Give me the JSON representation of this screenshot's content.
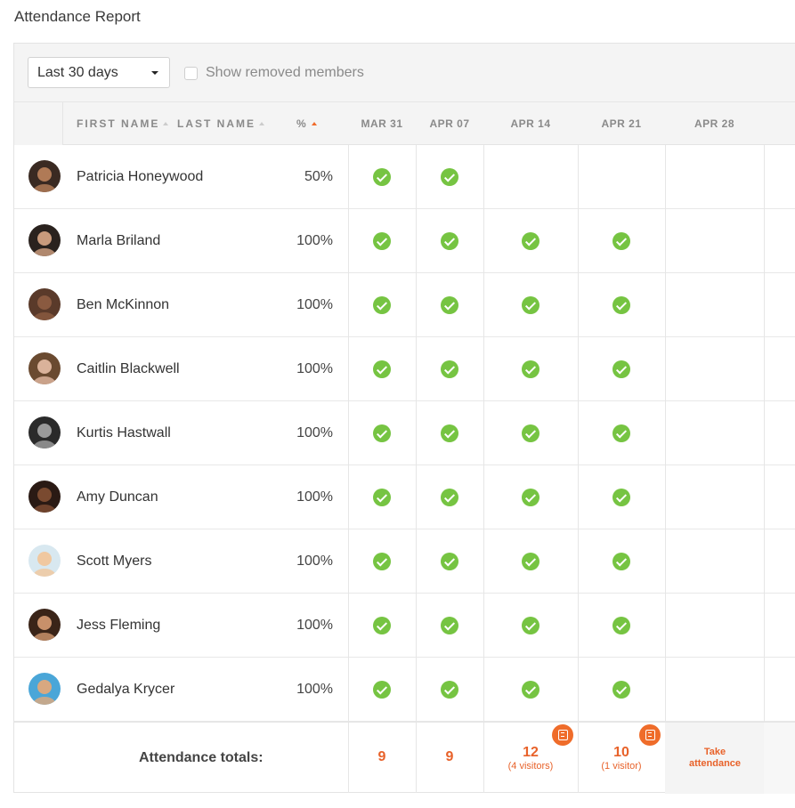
{
  "page": {
    "title": "Attendance Report"
  },
  "filters": {
    "range_label": "Last 30 days",
    "show_removed_label": "Show removed members",
    "show_removed_checked": false
  },
  "columns": {
    "first_name": "FIRST NAME",
    "last_name": "LAST NAME",
    "percent": "%",
    "dates": [
      "MAR 31",
      "APR 07",
      "APR 14",
      "APR 21",
      "APR 28"
    ]
  },
  "members": [
    {
      "name": "Patricia Honeywood",
      "percent": "50%",
      "attended": [
        true,
        true,
        false,
        false,
        false
      ],
      "avatar_color": "#3a2a22",
      "avatar_skin": "#b07a56"
    },
    {
      "name": "Marla Briland",
      "percent": "100%",
      "attended": [
        true,
        true,
        true,
        true,
        false
      ],
      "avatar_color": "#2a221e",
      "avatar_skin": "#c89a7c"
    },
    {
      "name": "Ben McKinnon",
      "percent": "100%",
      "attended": [
        true,
        true,
        true,
        true,
        false
      ],
      "avatar_color": "#5a3a2a",
      "avatar_skin": "#8a5a40"
    },
    {
      "name": "Caitlin Blackwell",
      "percent": "100%",
      "attended": [
        true,
        true,
        true,
        true,
        false
      ],
      "avatar_color": "#6a4a30",
      "avatar_skin": "#dab29a"
    },
    {
      "name": "Kurtis Hastwall",
      "percent": "100%",
      "attended": [
        true,
        true,
        true,
        true,
        false
      ],
      "avatar_color": "#2a2a2a",
      "avatar_skin": "#9a9a9a"
    },
    {
      "name": "Amy Duncan",
      "percent": "100%",
      "attended": [
        true,
        true,
        true,
        true,
        false
      ],
      "avatar_color": "#2a1a14",
      "avatar_skin": "#7a4a30"
    },
    {
      "name": "Scott Myers",
      "percent": "100%",
      "attended": [
        true,
        true,
        true,
        true,
        false
      ],
      "avatar_color": "#d8e8f0",
      "avatar_skin": "#f0c8a0"
    },
    {
      "name": "Jess Fleming",
      "percent": "100%",
      "attended": [
        true,
        true,
        true,
        true,
        false
      ],
      "avatar_color": "#3a2418",
      "avatar_skin": "#c8906a"
    },
    {
      "name": "Gedalya Krycer",
      "percent": "100%",
      "attended": [
        true,
        true,
        true,
        true,
        false
      ],
      "avatar_color": "#4aa6d8",
      "avatar_skin": "#d8a880"
    }
  ],
  "totals": {
    "label": "Attendance totals:",
    "counts": [
      "9",
      "9",
      "12",
      "10"
    ],
    "visitors": [
      "",
      "",
      "(4 visitors)",
      "(1 visitor)"
    ],
    "has_note": [
      false,
      false,
      true,
      true
    ],
    "take_attendance_label": "Take attendance"
  },
  "colors": {
    "accent": "#e8622a",
    "check": "#76c442",
    "grey_column": "#f4f4f4"
  }
}
